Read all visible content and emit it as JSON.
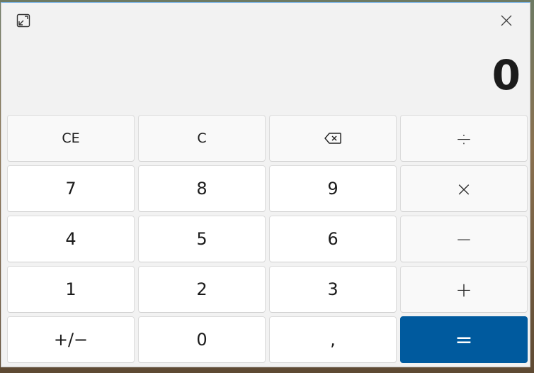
{
  "window": {
    "compact_icon": "compact-overlay-icon",
    "close_icon": "close-icon"
  },
  "display": {
    "value": "0"
  },
  "keys": {
    "ce": "CE",
    "c": "C",
    "backspace_icon": "backspace-icon",
    "divide": "÷",
    "seven": "7",
    "eight": "8",
    "nine": "9",
    "multiply": "×",
    "four": "4",
    "five": "5",
    "six": "6",
    "minus": "−",
    "one": "1",
    "two": "2",
    "three": "3",
    "plus": "+",
    "negate": "+/−",
    "zero": "0",
    "decimal": ",",
    "equals": "="
  },
  "colors": {
    "accent": "#005a9e",
    "background": "#f2f2f2",
    "digit_key": "#ffffff",
    "op_key": "#f9f9f9"
  }
}
